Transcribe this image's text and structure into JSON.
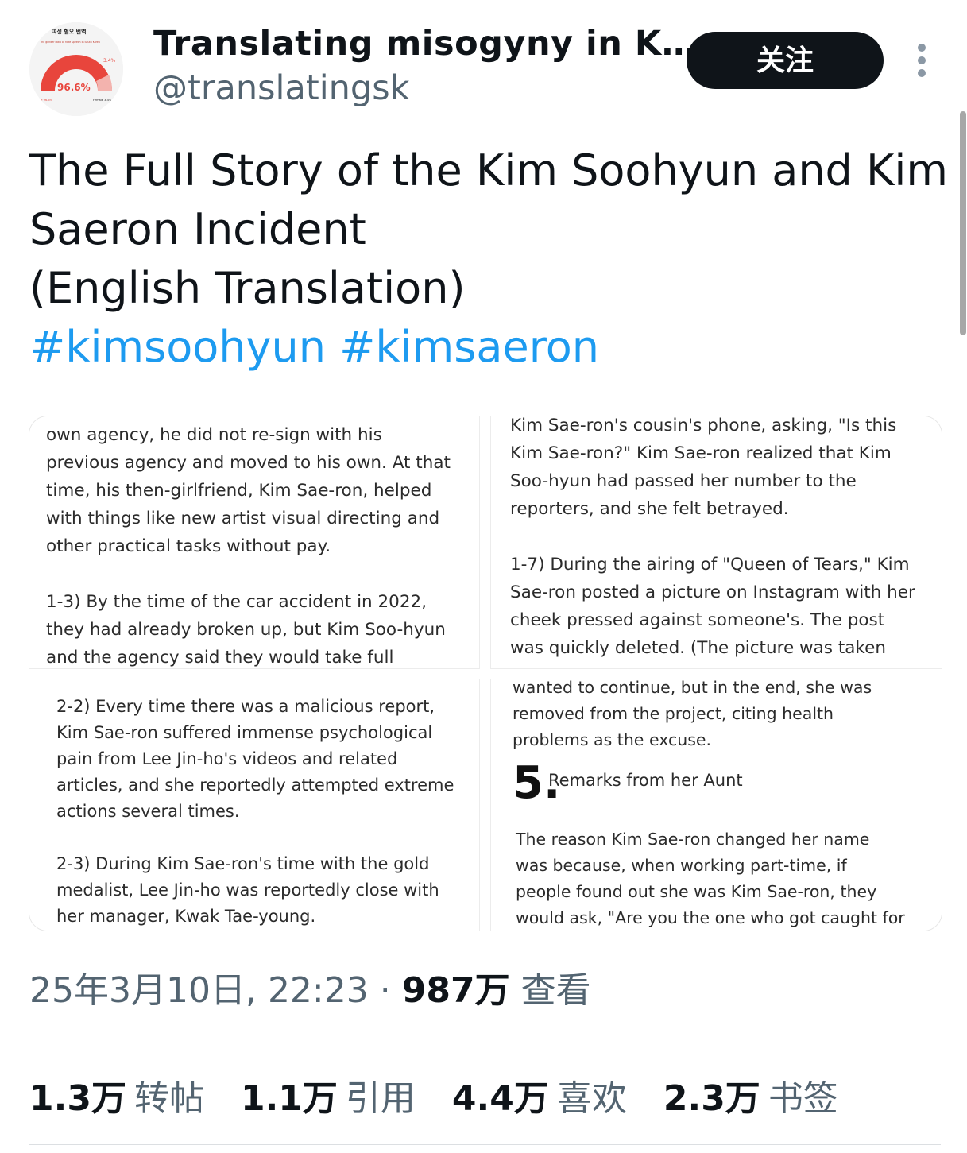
{
  "header": {
    "avatar": {
      "title_text": "여성 혐오 번역",
      "subtitle_text": "the gender ratio of hate speech in South Korea",
      "big_percent": "96.6%",
      "small_percent": "3.4%",
      "left_caption": "Male 96.6%",
      "right_caption": "Female 3.4%"
    },
    "display_name": "Translating misogyny in K…",
    "handle": "@translatingsk",
    "follow_label": "关注"
  },
  "tweet": {
    "line1": "The Full Story of the Kim Soohyun and Kim",
    "line2": "Saeron Incident",
    "line3": "(English Translation)",
    "hashtag1": "#kimsoohyun",
    "hashtag2": "#kimsaeron"
  },
  "media": {
    "image1": {
      "lines_a": [
        "own agency, he did not re-sign with his",
        "previous agency and moved to his own. At that",
        "time, his then-girlfriend, Kim Sae-ron, helped",
        "with things like new artist visual directing and",
        "other practical tasks without pay."
      ],
      "lines_b": [
        "1-3) By the time of the car accident in 2022,",
        "they had already broken up, but Kim Soo-hyun",
        "and the agency said they would take full"
      ]
    },
    "image2": {
      "lines_a": [
        "Kim Sae-ron's cousin's phone, asking, \"Is this",
        "Kim Sae-ron?\" Kim Sae-ron realized that Kim",
        "Soo-hyun had passed her number to the",
        "reporters, and she felt betrayed."
      ],
      "lines_b": [
        "1-7) During the airing of \"Queen of Tears,\" Kim",
        "Sae-ron posted a picture on Instagram with her",
        "cheek pressed against someone's. The post",
        "was quickly deleted. (The picture was taken"
      ]
    },
    "image3": {
      "lines_a": [
        "2-2) Every time there was a malicious report,",
        "Kim Sae-ron suffered immense psychological",
        "pain from Lee Jin-ho's videos and related",
        "articles, and she reportedly attempted extreme",
        "actions several times."
      ],
      "lines_b": [
        "2-3) During Kim Sae-ron's time with the gold",
        "medalist, Lee Jin-ho was reportedly close with",
        "her manager, Kwak Tae-young."
      ]
    },
    "image4": {
      "lines_a": [
        "wanted to continue, but in the end, she was",
        "removed from the project, citing health",
        "problems as the excuse."
      ],
      "section_number": "5.",
      "section_title": "Remarks from her Aunt",
      "lines_b": [
        "The reason Kim Sae-ron changed her name",
        "was because, when working part-time, if",
        "people found out she was Kim Sae-ron, they",
        "would ask, \"Are you the one who got caught for"
      ]
    }
  },
  "meta": {
    "timestamp": "25年3月10日, 22:23",
    "separator": "·",
    "views_count": "987万",
    "views_label": "查看"
  },
  "stats": [
    {
      "count": "1.3万",
      "label": "转帖"
    },
    {
      "count": "1.1万",
      "label": "引用"
    },
    {
      "count": "4.4万",
      "label": "喜欢"
    },
    {
      "count": "2.3万",
      "label": "书签"
    }
  ],
  "colors": {
    "link": "#1d9bf0",
    "text_primary": "#0f1419",
    "text_secondary": "#536471",
    "button_bg": "#0f1419",
    "avatar_gauge": "#e8453c"
  },
  "icons": {
    "more": "more-vertical-icon"
  }
}
